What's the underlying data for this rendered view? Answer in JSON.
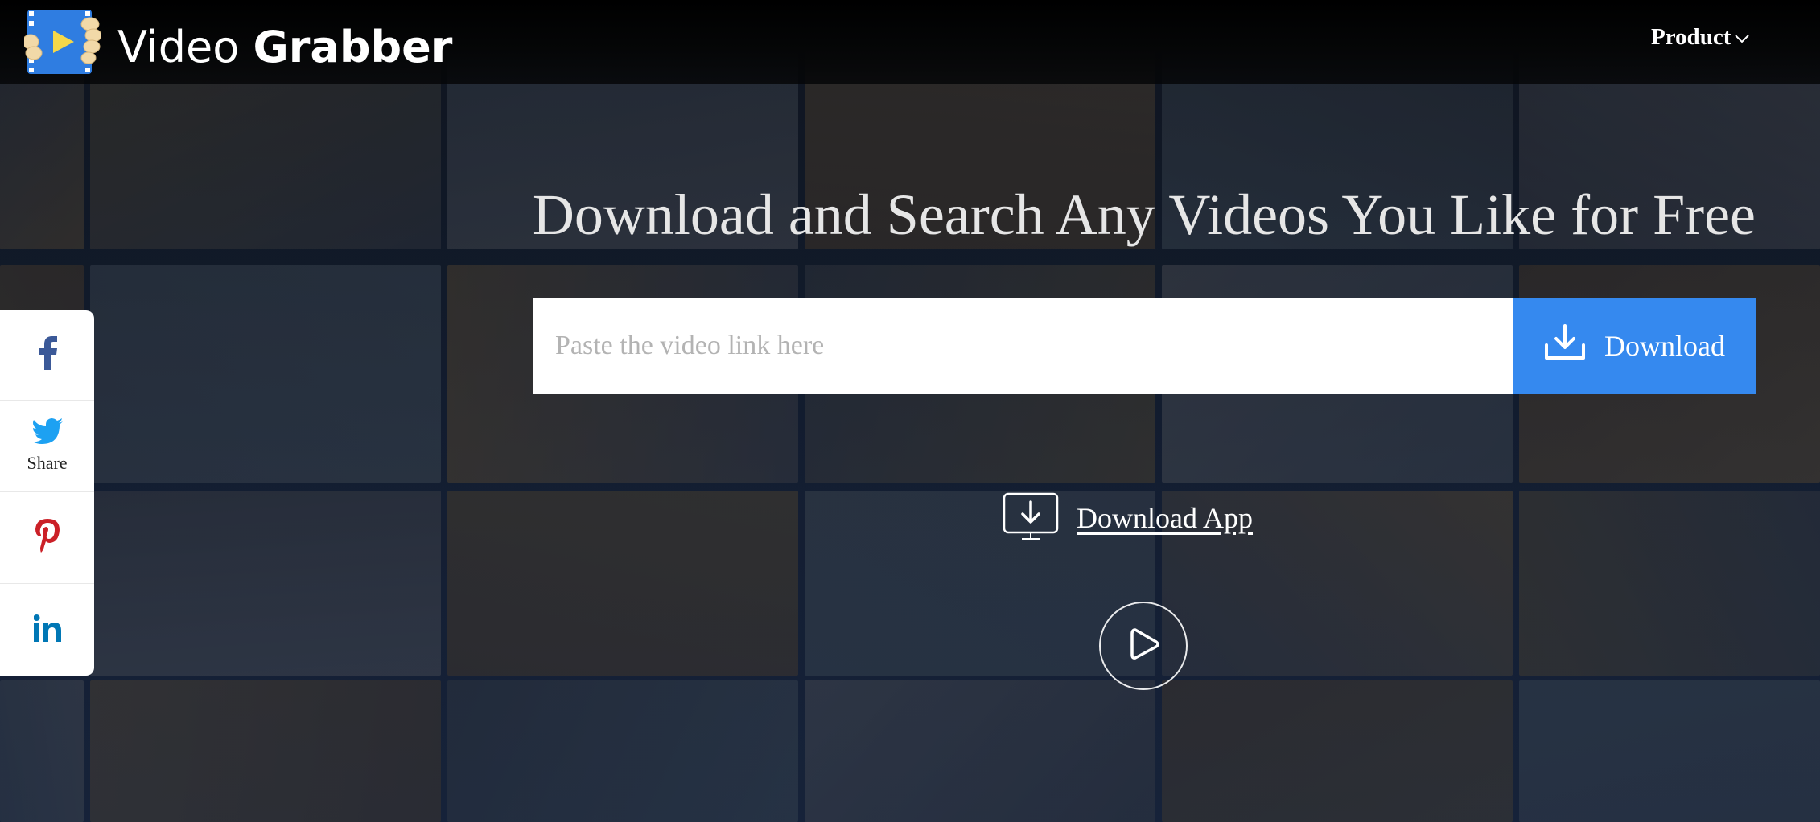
{
  "header": {
    "brand_light": "Video ",
    "brand_bold": "Grabber",
    "nav": {
      "product_label": "Product"
    }
  },
  "hero": {
    "title": "Download and Search Any Videos You Like for Free",
    "search": {
      "placeholder": "Paste the video link here",
      "value": ""
    },
    "download_button_label": "Download",
    "download_app_label": "Download App"
  },
  "share_bar": {
    "items": [
      {
        "icon": "facebook-icon",
        "label": ""
      },
      {
        "icon": "twitter-icon",
        "label": "Share"
      },
      {
        "icon": "pinterest-icon",
        "label": ""
      },
      {
        "icon": "linkedin-icon",
        "label": ""
      }
    ]
  },
  "colors": {
    "accent_blue": "#3589ef",
    "facebook": "#3b5998",
    "twitter": "#1da1f2",
    "pinterest": "#cb2027",
    "linkedin": "#0077b5",
    "logo_blue": "#2f7de1",
    "logo_yellow": "#f5d84a",
    "logo_hand": "#f2d9a8"
  }
}
